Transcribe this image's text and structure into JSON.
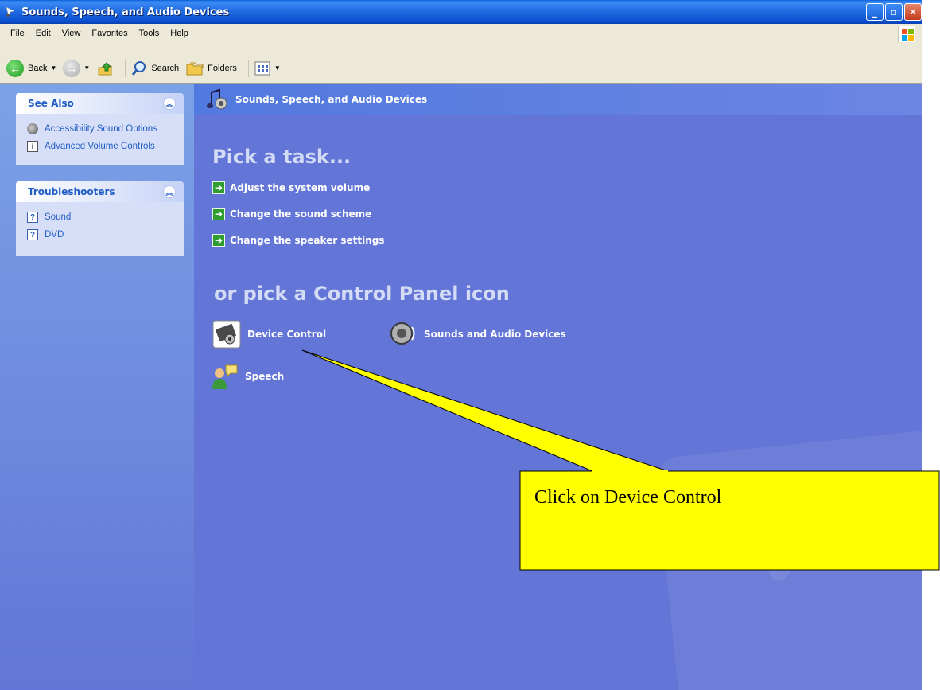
{
  "window": {
    "title": "Sounds, Speech, and Audio Devices",
    "buttons": [
      "minimize",
      "restore",
      "close"
    ]
  },
  "menubar": {
    "items": [
      "File",
      "Edit",
      "View",
      "Favorites",
      "Tools",
      "Help"
    ]
  },
  "toolbar": {
    "back_label": "Back",
    "search_label": "Search",
    "folders_label": "Folders"
  },
  "sidebar": {
    "see_also": {
      "title": "See Also",
      "items": [
        {
          "label": "Accessibility Sound Options",
          "icon": "speaker-icon"
        },
        {
          "label": "Advanced Volume Controls",
          "icon": "info-icon"
        }
      ]
    },
    "troubleshooters": {
      "title": "Troubleshooters",
      "items": [
        {
          "label": "Sound",
          "icon": "help-icon"
        },
        {
          "label": "DVD",
          "icon": "help-icon"
        }
      ]
    }
  },
  "main": {
    "header": "Sounds, Speech, and Audio Devices",
    "pick_task": "Pick a task...",
    "tasks": [
      "Adjust the system volume",
      "Change the sound scheme",
      "Change the speaker settings"
    ],
    "or_pick": "or pick a Control Panel icon",
    "icons": [
      {
        "label": "Device Control",
        "icon": "device-control-icon"
      },
      {
        "label": "Sounds and Audio Devices",
        "icon": "speaker-icon"
      },
      {
        "label": "Speech",
        "icon": "speech-icon"
      }
    ]
  },
  "callout": {
    "text": "Click on Device Control",
    "fill": "#ffff00"
  },
  "colors": {
    "titlebar": "#0b50d0",
    "taskpane": "#7ba2e7",
    "main_bg": "#6375d6",
    "link": "#215dc6"
  }
}
